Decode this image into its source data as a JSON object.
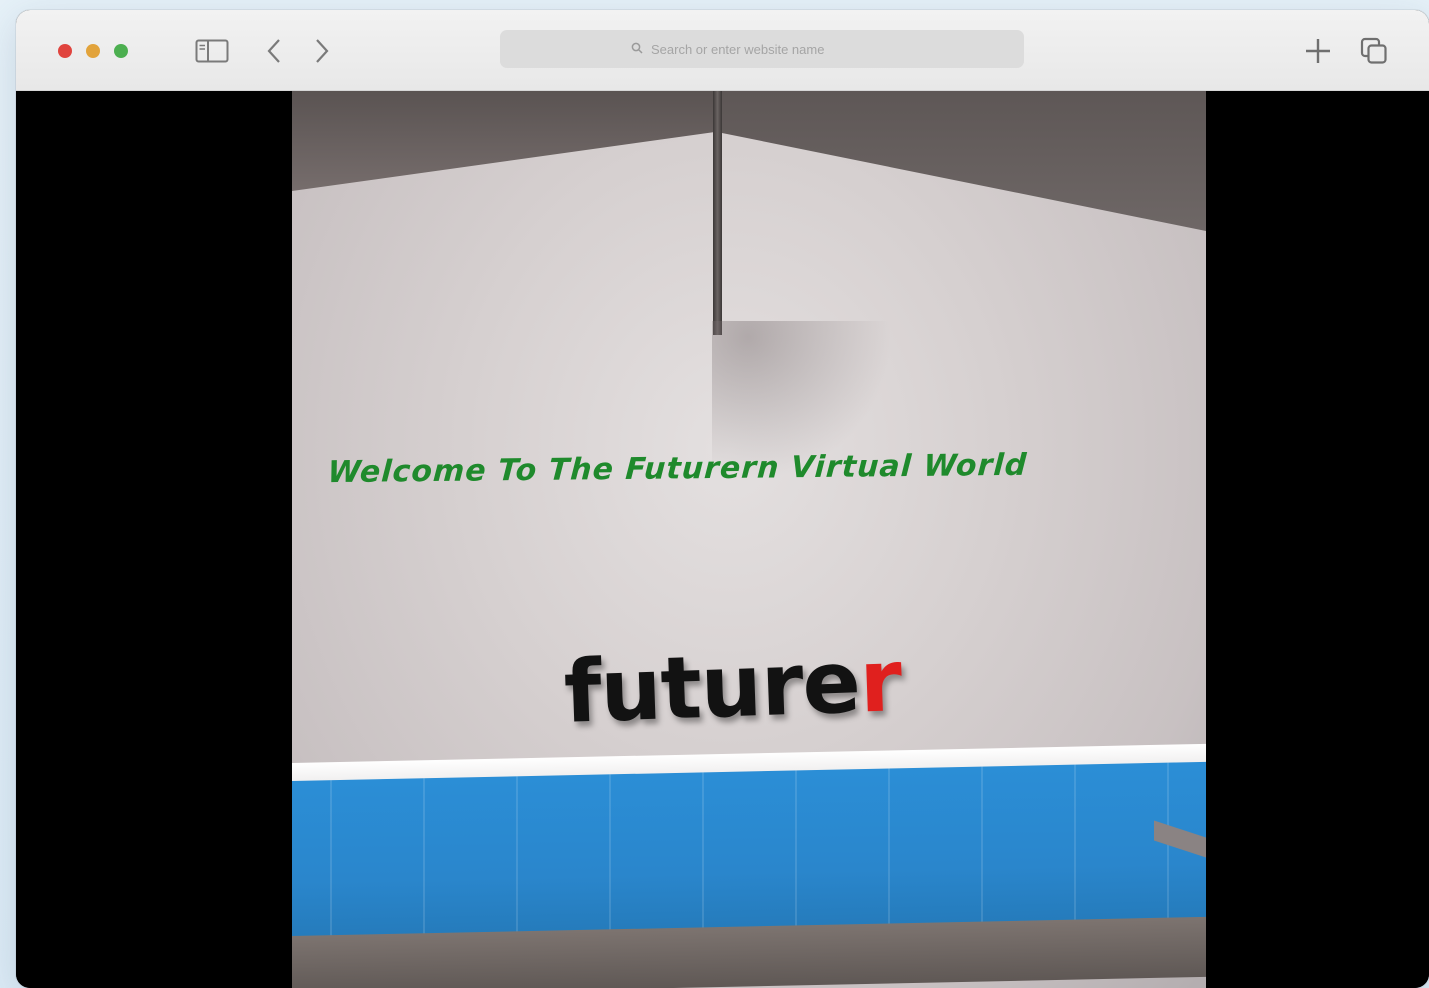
{
  "browser": {
    "address_placeholder": "Search or enter website name",
    "icons": {
      "sidebar": "sidebar-icon",
      "back": "chevron-left-icon",
      "forward": "chevron-right-icon",
      "search": "search-icon",
      "new_tab": "plus-icon",
      "tabs": "tabs-overview-icon"
    },
    "traffic_lights": [
      "close",
      "minimize",
      "zoom"
    ]
  },
  "scene": {
    "welcome_text": "Welcome To The Futurern Virtual World",
    "logo_text_main": "future",
    "logo_text_accent": "r",
    "colors": {
      "welcome": "#1f8a2c",
      "logo": "#121212",
      "logo_accent": "#e0201e",
      "stripe": "#2b8ed6"
    }
  }
}
